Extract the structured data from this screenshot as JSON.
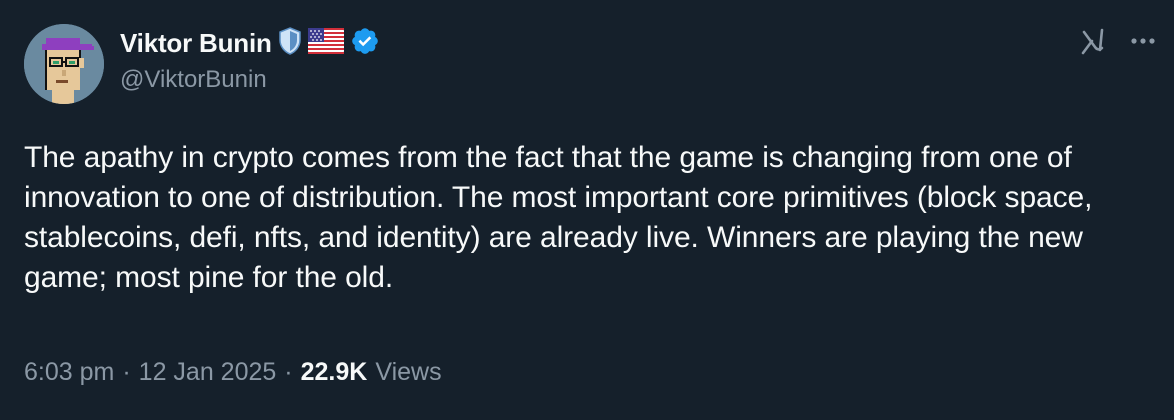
{
  "author": {
    "display_name": "Viktor Bunin",
    "handle": "@ViktorBunin",
    "badges": [
      "shield-icon",
      "us-flag-icon",
      "verified-icon"
    ]
  },
  "tweet": {
    "text": "The apathy in crypto comes from the fact that the game is changing from one of innovation to one of distribution. The most important core primitives (block space, stablecoins, defi, nfts, and identity) are already live. Winners are playing the new game; most pine for the old."
  },
  "meta": {
    "time": "6:03 pm",
    "date": "12 Jan 2025",
    "views_count": "22.9K",
    "views_label": "Views",
    "separator": "·"
  },
  "actions": [
    "grok-icon",
    "more-icon"
  ],
  "colors": {
    "background": "#15202b",
    "text": "#f7f9f9",
    "secondary": "#8b98a5",
    "verified": "#1d9bf0"
  }
}
